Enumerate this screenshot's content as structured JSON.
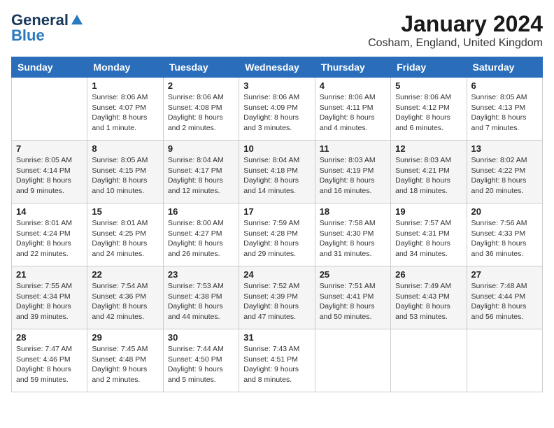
{
  "header": {
    "logo_general": "General",
    "logo_blue": "Blue",
    "month_year": "January 2024",
    "location": "Cosham, England, United Kingdom"
  },
  "weekdays": [
    "Sunday",
    "Monday",
    "Tuesday",
    "Wednesday",
    "Thursday",
    "Friday",
    "Saturday"
  ],
  "weeks": [
    [
      {
        "day": "",
        "sunrise": "",
        "sunset": "",
        "daylight": ""
      },
      {
        "day": "1",
        "sunrise": "Sunrise: 8:06 AM",
        "sunset": "Sunset: 4:07 PM",
        "daylight": "Daylight: 8 hours and 1 minute."
      },
      {
        "day": "2",
        "sunrise": "Sunrise: 8:06 AM",
        "sunset": "Sunset: 4:08 PM",
        "daylight": "Daylight: 8 hours and 2 minutes."
      },
      {
        "day": "3",
        "sunrise": "Sunrise: 8:06 AM",
        "sunset": "Sunset: 4:09 PM",
        "daylight": "Daylight: 8 hours and 3 minutes."
      },
      {
        "day": "4",
        "sunrise": "Sunrise: 8:06 AM",
        "sunset": "Sunset: 4:11 PM",
        "daylight": "Daylight: 8 hours and 4 minutes."
      },
      {
        "day": "5",
        "sunrise": "Sunrise: 8:06 AM",
        "sunset": "Sunset: 4:12 PM",
        "daylight": "Daylight: 8 hours and 6 minutes."
      },
      {
        "day": "6",
        "sunrise": "Sunrise: 8:05 AM",
        "sunset": "Sunset: 4:13 PM",
        "daylight": "Daylight: 8 hours and 7 minutes."
      }
    ],
    [
      {
        "day": "7",
        "sunrise": "Sunrise: 8:05 AM",
        "sunset": "Sunset: 4:14 PM",
        "daylight": "Daylight: 8 hours and 9 minutes."
      },
      {
        "day": "8",
        "sunrise": "Sunrise: 8:05 AM",
        "sunset": "Sunset: 4:15 PM",
        "daylight": "Daylight: 8 hours and 10 minutes."
      },
      {
        "day": "9",
        "sunrise": "Sunrise: 8:04 AM",
        "sunset": "Sunset: 4:17 PM",
        "daylight": "Daylight: 8 hours and 12 minutes."
      },
      {
        "day": "10",
        "sunrise": "Sunrise: 8:04 AM",
        "sunset": "Sunset: 4:18 PM",
        "daylight": "Daylight: 8 hours and 14 minutes."
      },
      {
        "day": "11",
        "sunrise": "Sunrise: 8:03 AM",
        "sunset": "Sunset: 4:19 PM",
        "daylight": "Daylight: 8 hours and 16 minutes."
      },
      {
        "day": "12",
        "sunrise": "Sunrise: 8:03 AM",
        "sunset": "Sunset: 4:21 PM",
        "daylight": "Daylight: 8 hours and 18 minutes."
      },
      {
        "day": "13",
        "sunrise": "Sunrise: 8:02 AM",
        "sunset": "Sunset: 4:22 PM",
        "daylight": "Daylight: 8 hours and 20 minutes."
      }
    ],
    [
      {
        "day": "14",
        "sunrise": "Sunrise: 8:01 AM",
        "sunset": "Sunset: 4:24 PM",
        "daylight": "Daylight: 8 hours and 22 minutes."
      },
      {
        "day": "15",
        "sunrise": "Sunrise: 8:01 AM",
        "sunset": "Sunset: 4:25 PM",
        "daylight": "Daylight: 8 hours and 24 minutes."
      },
      {
        "day": "16",
        "sunrise": "Sunrise: 8:00 AM",
        "sunset": "Sunset: 4:27 PM",
        "daylight": "Daylight: 8 hours and 26 minutes."
      },
      {
        "day": "17",
        "sunrise": "Sunrise: 7:59 AM",
        "sunset": "Sunset: 4:28 PM",
        "daylight": "Daylight: 8 hours and 29 minutes."
      },
      {
        "day": "18",
        "sunrise": "Sunrise: 7:58 AM",
        "sunset": "Sunset: 4:30 PM",
        "daylight": "Daylight: 8 hours and 31 minutes."
      },
      {
        "day": "19",
        "sunrise": "Sunrise: 7:57 AM",
        "sunset": "Sunset: 4:31 PM",
        "daylight": "Daylight: 8 hours and 34 minutes."
      },
      {
        "day": "20",
        "sunrise": "Sunrise: 7:56 AM",
        "sunset": "Sunset: 4:33 PM",
        "daylight": "Daylight: 8 hours and 36 minutes."
      }
    ],
    [
      {
        "day": "21",
        "sunrise": "Sunrise: 7:55 AM",
        "sunset": "Sunset: 4:34 PM",
        "daylight": "Daylight: 8 hours and 39 minutes."
      },
      {
        "day": "22",
        "sunrise": "Sunrise: 7:54 AM",
        "sunset": "Sunset: 4:36 PM",
        "daylight": "Daylight: 8 hours and 42 minutes."
      },
      {
        "day": "23",
        "sunrise": "Sunrise: 7:53 AM",
        "sunset": "Sunset: 4:38 PM",
        "daylight": "Daylight: 8 hours and 44 minutes."
      },
      {
        "day": "24",
        "sunrise": "Sunrise: 7:52 AM",
        "sunset": "Sunset: 4:39 PM",
        "daylight": "Daylight: 8 hours and 47 minutes."
      },
      {
        "day": "25",
        "sunrise": "Sunrise: 7:51 AM",
        "sunset": "Sunset: 4:41 PM",
        "daylight": "Daylight: 8 hours and 50 minutes."
      },
      {
        "day": "26",
        "sunrise": "Sunrise: 7:49 AM",
        "sunset": "Sunset: 4:43 PM",
        "daylight": "Daylight: 8 hours and 53 minutes."
      },
      {
        "day": "27",
        "sunrise": "Sunrise: 7:48 AM",
        "sunset": "Sunset: 4:44 PM",
        "daylight": "Daylight: 8 hours and 56 minutes."
      }
    ],
    [
      {
        "day": "28",
        "sunrise": "Sunrise: 7:47 AM",
        "sunset": "Sunset: 4:46 PM",
        "daylight": "Daylight: 8 hours and 59 minutes."
      },
      {
        "day": "29",
        "sunrise": "Sunrise: 7:45 AM",
        "sunset": "Sunset: 4:48 PM",
        "daylight": "Daylight: 9 hours and 2 minutes."
      },
      {
        "day": "30",
        "sunrise": "Sunrise: 7:44 AM",
        "sunset": "Sunset: 4:50 PM",
        "daylight": "Daylight: 9 hours and 5 minutes."
      },
      {
        "day": "31",
        "sunrise": "Sunrise: 7:43 AM",
        "sunset": "Sunset: 4:51 PM",
        "daylight": "Daylight: 9 hours and 8 minutes."
      },
      {
        "day": "",
        "sunrise": "",
        "sunset": "",
        "daylight": ""
      },
      {
        "day": "",
        "sunrise": "",
        "sunset": "",
        "daylight": ""
      },
      {
        "day": "",
        "sunrise": "",
        "sunset": "",
        "daylight": ""
      }
    ]
  ]
}
